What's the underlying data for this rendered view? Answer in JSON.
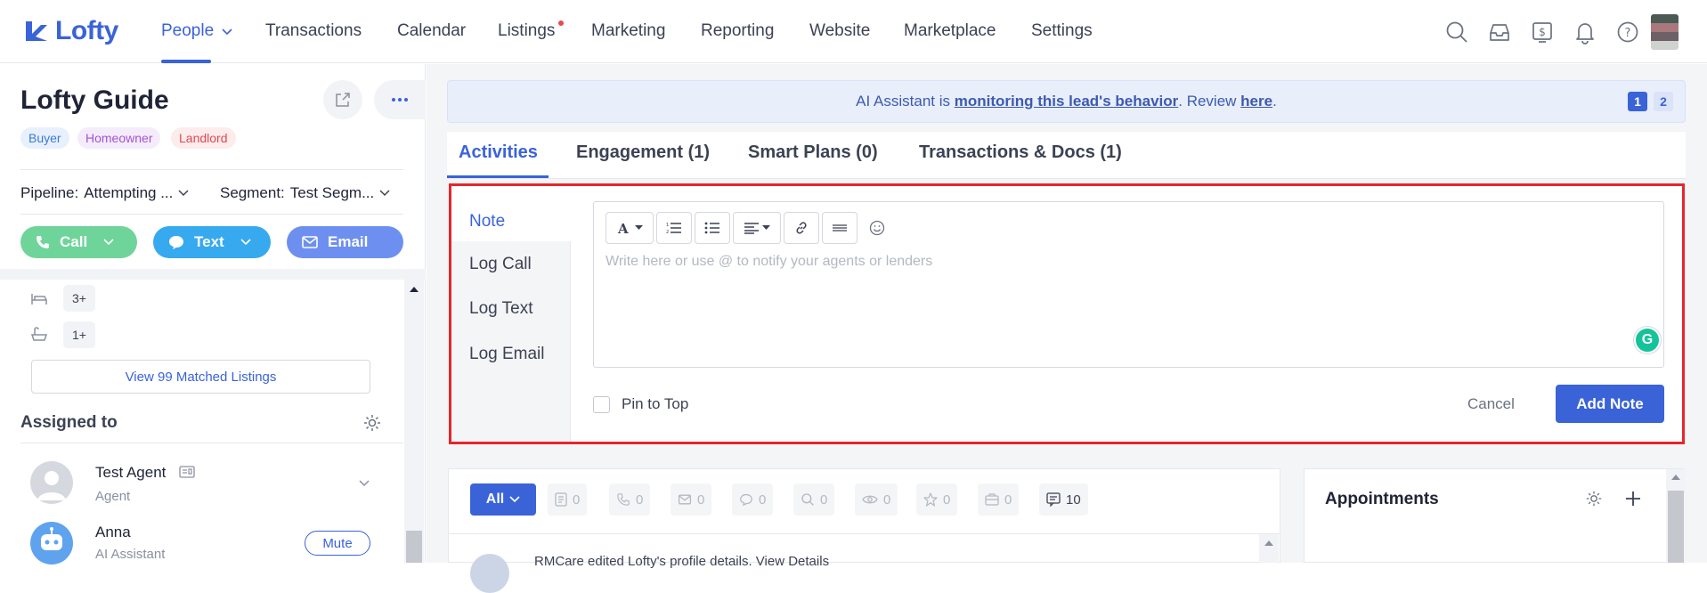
{
  "brand": {
    "name": "Lofty",
    "accent": "#3a63d8",
    "highlight_border": "#e5262b"
  },
  "nav": {
    "items": [
      "People",
      "Transactions",
      "Calendar",
      "Listings",
      "Marketing",
      "Reporting",
      "Website",
      "Marketplace",
      "Settings"
    ],
    "active": "People",
    "icons": [
      "search-icon",
      "inbox-icon",
      "billing-icon",
      "bell-icon",
      "help-icon"
    ]
  },
  "lead": {
    "name": "Lofty Guide",
    "tags": [
      "Buyer",
      "Homeowner",
      "Landlord"
    ],
    "pipeline_label": "Pipeline:",
    "pipeline_value": "Attempting ...",
    "segment_label": "Segment:",
    "segment_value": "Test Segm..."
  },
  "actions": {
    "call": "Call",
    "text": "Text",
    "email": "Email"
  },
  "criteria": {
    "beds": "3+",
    "baths": "1+"
  },
  "matched_listings_label": "View 99 Matched Listings",
  "assigned": {
    "title": "Assigned to",
    "people": [
      {
        "name": "Test Agent",
        "role": "Agent"
      },
      {
        "name": "Anna",
        "role": "AI Assistant",
        "action": "Mute"
      }
    ]
  },
  "ai_banner": {
    "prefix": "AI Assistant is ",
    "link": "monitoring this lead's behavior",
    "middle": ". Review ",
    "link2": "here",
    "suffix": ".",
    "pages": [
      "1",
      "2"
    ]
  },
  "tabs": [
    "Activities",
    "Engagement (1)",
    "Smart Plans (0)",
    "Transactions & Docs (1)"
  ],
  "composer": {
    "side_tabs": [
      "Note",
      "Log Call",
      "Log Text",
      "Log Email"
    ],
    "placeholder": "Write here or use @ to notify your agents or lenders",
    "pin_label": "Pin to Top",
    "cancel": "Cancel",
    "submit": "Add Note",
    "toolbar": [
      "font-icon",
      "ordered-list-icon",
      "bullet-list-icon",
      "align-icon",
      "link-icon",
      "divider-icon",
      "emoji-icon"
    ]
  },
  "feed": {
    "filter_all": "All",
    "counts": [
      "0",
      "0",
      "0",
      "0",
      "0",
      "0",
      "0",
      "0",
      "10"
    ],
    "first_row": "RMCare edited Lofty's profile details. View Details"
  },
  "appointments": {
    "title": "Appointments"
  }
}
